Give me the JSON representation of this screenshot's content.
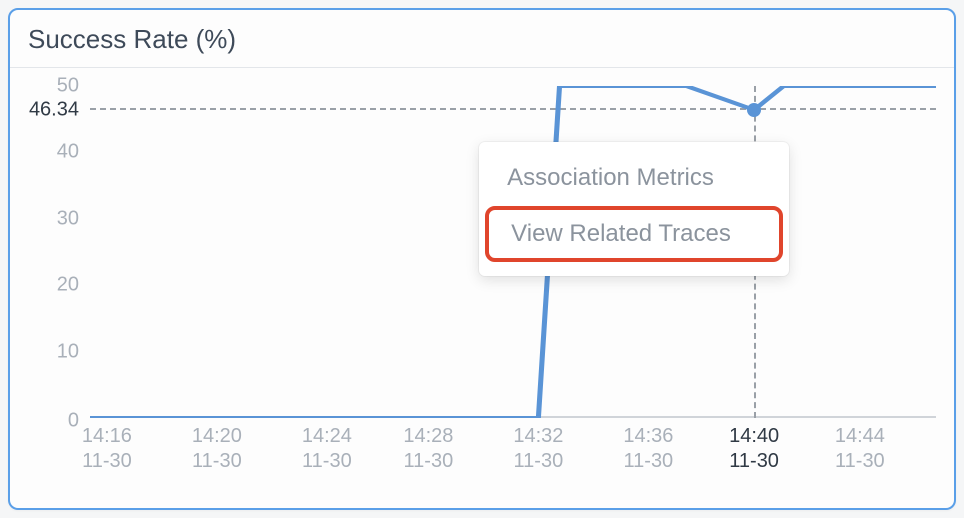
{
  "title": "Success Rate (%)",
  "chart_data": {
    "type": "line",
    "xlabel": "",
    "ylabel": "",
    "ylim": [
      0,
      50
    ],
    "y_ticks": [
      0,
      10,
      20,
      30,
      40,
      50
    ],
    "categories": [
      "14:16",
      "14:20",
      "14:24",
      "14:28",
      "14:32",
      "14:36",
      "14:40",
      "14:44"
    ],
    "date_labels": [
      "11-30",
      "11-30",
      "11-30",
      "11-30",
      "11-30",
      "11-30",
      "11-30",
      "11-30"
    ],
    "series": [
      {
        "name": "Success Rate",
        "color": "#5a94d6",
        "values": [
          0,
          0,
          0,
          0,
          0,
          50,
          50,
          46.34,
          50,
          50
        ]
      }
    ],
    "hover": {
      "x_category": "14:40",
      "x_date": "11-30",
      "value": 46.34
    }
  },
  "menu": {
    "items": [
      {
        "label": "Association Metrics",
        "highlight": false
      },
      {
        "label": "View Related Traces",
        "highlight": true
      }
    ]
  }
}
